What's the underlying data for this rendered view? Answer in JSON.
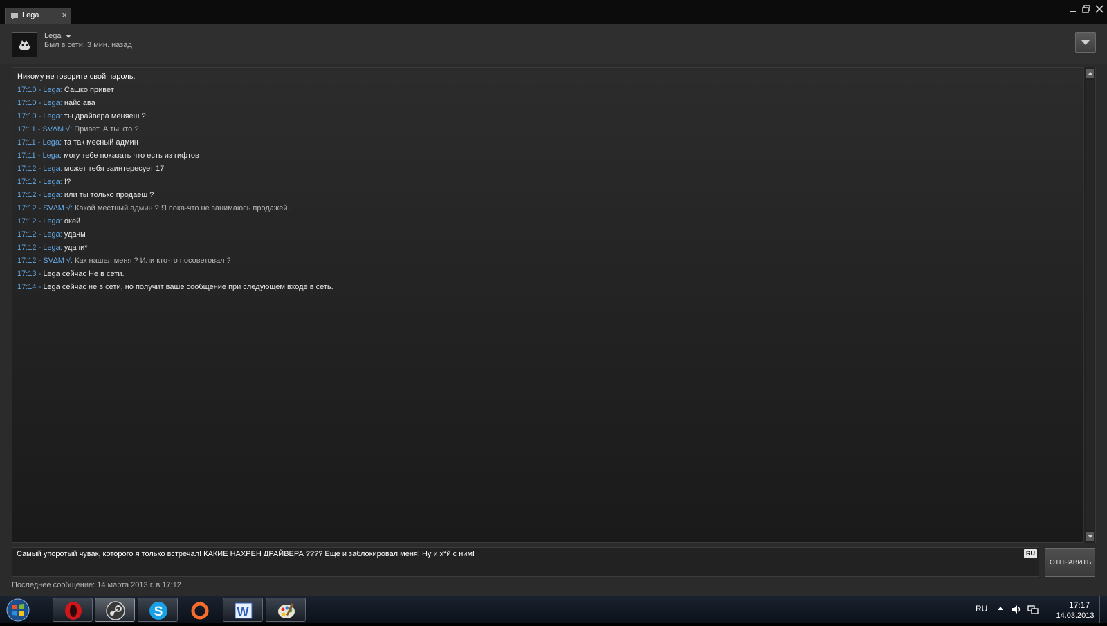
{
  "window": {
    "tab_label": "Lega",
    "tab_close": "×"
  },
  "header": {
    "friend_name": "Lega",
    "friend_status": "Был в сети: 3 мин. назад"
  },
  "chat": {
    "warning": "Никому не говорите свой пароль.",
    "messages": [
      {
        "meta": "17:10 - Lega",
        "sep": ": ",
        "text": "Сашко привет"
      },
      {
        "meta": "17:10 - Lega",
        "sep": ": ",
        "text": "найс ава"
      },
      {
        "meta": "17:10 - Lega",
        "sep": ": ",
        "text": "ты драйвера меняеш ?"
      },
      {
        "meta": "17:11 - SV∆M √",
        "sep": ": ",
        "text": "Привет. А ты кто ?",
        "me": true
      },
      {
        "meta": "17:11 - Lega",
        "sep": ": ",
        "text": "та так месный админ"
      },
      {
        "meta": "17:11 - Lega",
        "sep": ": ",
        "text": "могу тебе показать что есть из гифтов"
      },
      {
        "meta": "17:12 - Lega",
        "sep": ": ",
        "text": "может тебя заинтересует 17"
      },
      {
        "meta": "17:12 - Lega",
        "sep": ": ",
        "text": "!?"
      },
      {
        "meta": "17:12 - Lega",
        "sep": ": ",
        "text": "или ты только продаеш ?"
      },
      {
        "meta": "17:12 - SV∆M √",
        "sep": ": ",
        "text": "Какой местный админ ? Я пока-что не занимаюсь продажей.",
        "me": true
      },
      {
        "meta": "17:12 - Lega",
        "sep": ": ",
        "text": "окей"
      },
      {
        "meta": "17:12 - Lega",
        "sep": ": ",
        "text": "удачм"
      },
      {
        "meta": "17:12 - Lega",
        "sep": ": ",
        "text": "удачи*"
      },
      {
        "meta": "17:12 - SV∆M √",
        "sep": ": ",
        "text": "Как нашел меня ? Или кто-то посоветовал ?",
        "me": true
      },
      {
        "meta": "17:13 - ",
        "sep": "",
        "text": "Lega сейчас Не в сети.",
        "system": true
      },
      {
        "meta": "17:14 - ",
        "sep": "",
        "text": "Lega сейчас не в сети, но получит ваше сообщение при следующем входе в сеть.",
        "system": true
      }
    ]
  },
  "input": {
    "value": "Самый упоротый чувак, которого я только встречал! КАКИЕ НАХРЕН ДРАЙВЕРА ???? Еще и заблокировал меня! Ну и х*й с ним!",
    "lang": "RU"
  },
  "send_label": "ОТПРАВИТЬ",
  "last_message": "Последнее сообщение: 14 марта 2013 г. в 17:12",
  "taskbar": {
    "apps": [
      {
        "name": "opera",
        "icon": "opera-icon"
      },
      {
        "name": "steam",
        "icon": "steam-icon"
      },
      {
        "name": "skype",
        "icon": "skype-icon"
      },
      {
        "name": "origin",
        "icon": "origin-icon"
      },
      {
        "name": "word",
        "icon": "word-icon"
      },
      {
        "name": "paint",
        "icon": "paint-icon"
      }
    ],
    "lang": "RU",
    "time": "17:17",
    "date": "14.03.2013"
  },
  "colors": {
    "accent_meta": "#62a7e3",
    "window_bg": "#2b2b2b",
    "taskbar_bg": "#0b1018"
  }
}
